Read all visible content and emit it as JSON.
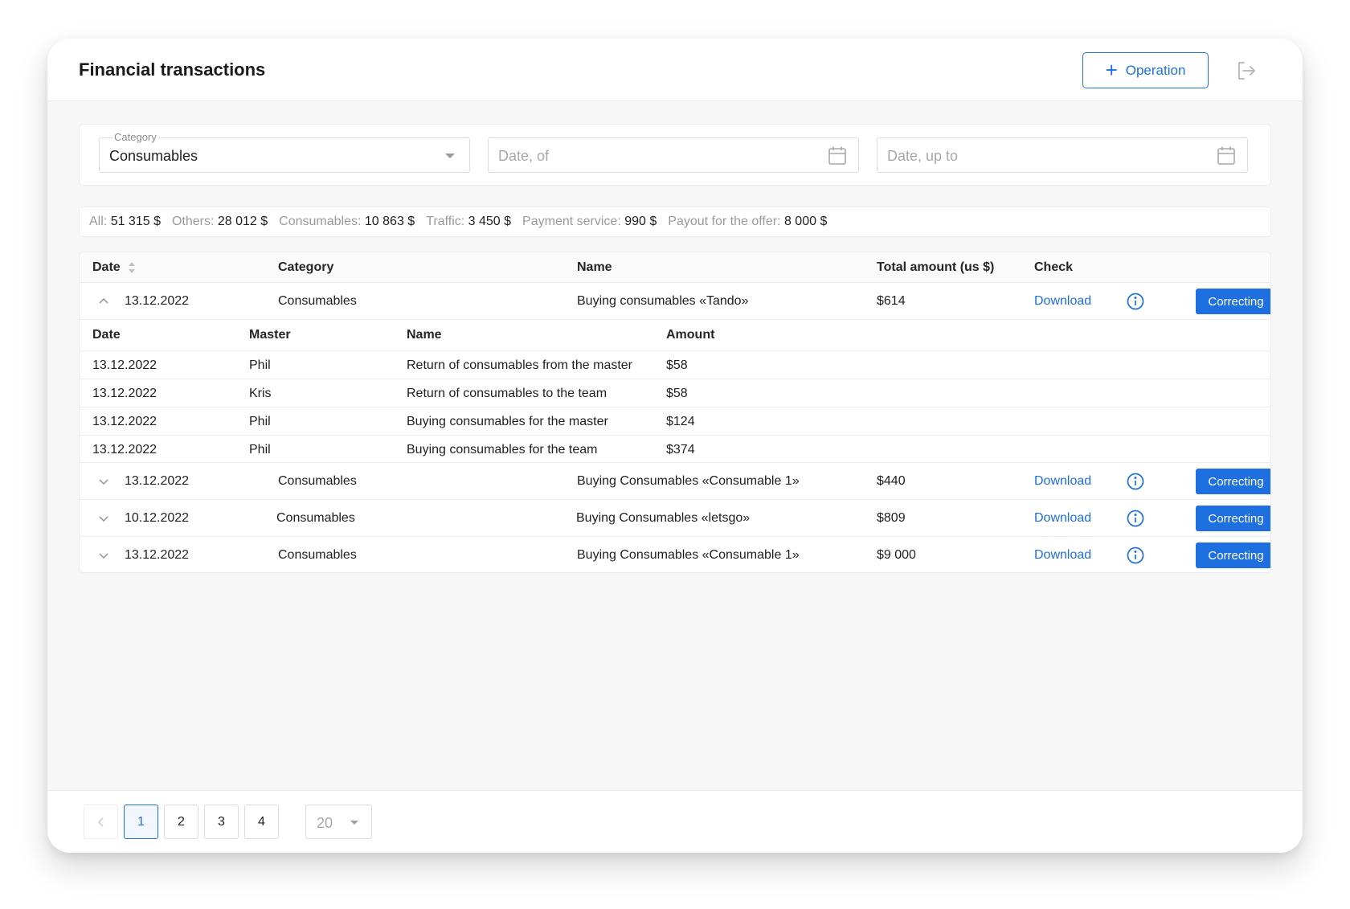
{
  "header": {
    "title": "Financial transactions",
    "operation_label": "Operation"
  },
  "filters": {
    "category": {
      "label": "Category",
      "value": "Consumables"
    },
    "date_from": {
      "placeholder": "Date, of"
    },
    "date_to": {
      "placeholder": "Date, up to"
    }
  },
  "totals": [
    {
      "label": "All:",
      "value": "51 315 $"
    },
    {
      "label": "Others:",
      "value": "28 012 $"
    },
    {
      "label": "Consumables:",
      "value": "10 863 $"
    },
    {
      "label": "Traffic:",
      "value": "3 450 $"
    },
    {
      "label": "Payment service:",
      "value": "990 $"
    },
    {
      "label": "Payout for the offer:",
      "value": "8 000 $"
    }
  ],
  "table": {
    "columns": {
      "date": "Date",
      "category": "Category",
      "name": "Name",
      "total": "Total amount (us $)",
      "check": "Check"
    },
    "rows": [
      {
        "date": "13.12.2022",
        "category": "Consumables",
        "name": "Buying consumables «Tando»",
        "amount": "$614",
        "check": "Download",
        "action": "Correcting",
        "expanded": true
      },
      {
        "date": "13.12.2022",
        "category": "Consumables",
        "name": "Buying Consumables «Consumable 1»",
        "amount": "$440",
        "check": "Download",
        "action": "Correcting",
        "expanded": false
      },
      {
        "date": "10.12.2022",
        "category": "Consumables",
        "name": "Buying Consumables «letsgo»",
        "amount": "$809",
        "check": "Download",
        "action": "Correcting",
        "expanded": false
      },
      {
        "date": "13.12.2022",
        "category": "Consumables",
        "name": "Buying Consumables «Consumable 1»",
        "amount": "$9 000",
        "check": "Download",
        "action": "Correcting",
        "expanded": false
      }
    ],
    "subtable": {
      "columns": {
        "date": "Date",
        "master": "Master",
        "name": "Name",
        "amount": "Amount"
      },
      "rows": [
        {
          "date": "13.12.2022",
          "master": "Phil",
          "name": "Return of consumables from the master",
          "amount": "$58"
        },
        {
          "date": "13.12.2022",
          "master": "Kris",
          "name": "Return of consumables to the team",
          "amount": "$58"
        },
        {
          "date": "13.12.2022",
          "master": "Phil",
          "name": "Buying consumables for the master",
          "amount": "$124"
        },
        {
          "date": "13.12.2022",
          "master": "Phil",
          "name": "Buying consumables for the team",
          "amount": "$374"
        }
      ]
    }
  },
  "pagination": {
    "pages": [
      "1",
      "2",
      "3",
      "4"
    ],
    "current": "1",
    "page_size": "20"
  },
  "colors": {
    "accent": "#1e6fe0",
    "muted": "#9a9a9a",
    "border": "#ececec"
  }
}
